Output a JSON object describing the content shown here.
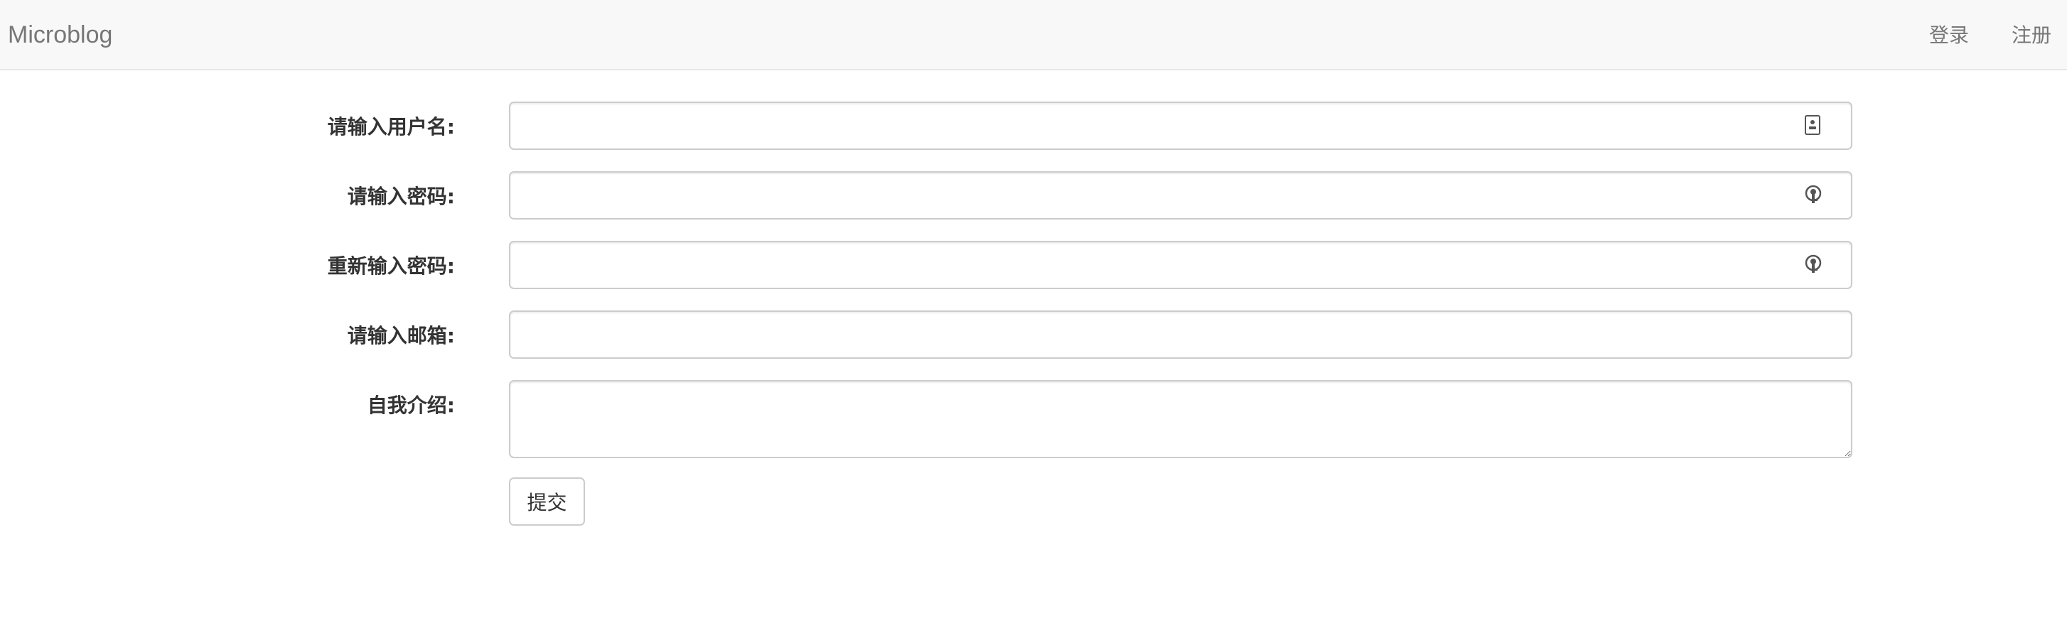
{
  "navbar": {
    "brand": "Microblog",
    "links": [
      {
        "label": "登录"
      },
      {
        "label": "注册"
      }
    ]
  },
  "form": {
    "username": {
      "label": "请输入用户名:",
      "value": "",
      "icon": "contact-card-icon"
    },
    "password": {
      "label": "请输入密码:",
      "value": "",
      "icon": "password-key-icon"
    },
    "password_confirm": {
      "label": "重新输入密码:",
      "value": "",
      "icon": "password-key-icon"
    },
    "email": {
      "label": "请输入邮箱:",
      "value": ""
    },
    "about": {
      "label": "自我介绍:",
      "value": ""
    },
    "submit_label": "提交"
  },
  "colors": {
    "navbar_bg": "#f8f8f8",
    "navbar_text": "#777777",
    "label_text": "#333333",
    "input_border": "#cccccc"
  }
}
